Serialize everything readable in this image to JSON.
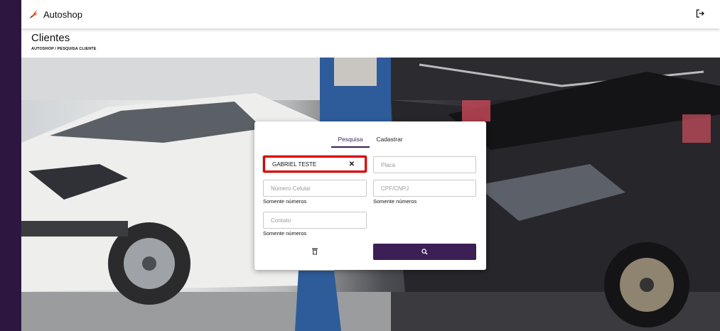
{
  "app": {
    "name": "Autoshop"
  },
  "page": {
    "title": "Clientes",
    "breadcrumb": "AUTOSHOP / PESQUISA CLIENTE"
  },
  "tabs": [
    {
      "label": "Pesquisa",
      "active": true
    },
    {
      "label": "Cadastrar",
      "active": false
    }
  ],
  "form": {
    "name": {
      "value": "GABRIEL TESTE",
      "placeholder": ""
    },
    "placa": {
      "value": "",
      "placeholder": "Placa"
    },
    "celular": {
      "value": "",
      "placeholder": "Número Celular",
      "hint": "Somente números"
    },
    "cpf": {
      "value": "",
      "placeholder": "CPF/CNPJ",
      "hint": "Somente números"
    },
    "contato": {
      "value": "",
      "placeholder": "Contato",
      "hint": "Somente números"
    }
  },
  "icons": {
    "logo": "autoshop-logo-icon",
    "logout": "logout-icon",
    "clear": "close-icon",
    "trash": "trash-icon",
    "search": "search-icon"
  },
  "colors": {
    "accent": "#3b1f55",
    "side_rail": "#2d1740",
    "logo": "#e8562a",
    "highlight": "#e00000"
  }
}
